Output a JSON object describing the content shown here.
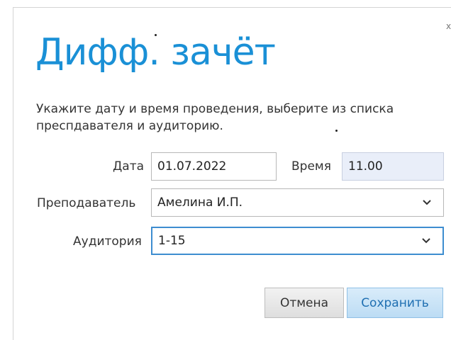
{
  "dialog": {
    "title": "Дифф. зачёт",
    "description": "Укажите дату и время проведения, выберите из списка преспдавателя и аудиторию.",
    "close_icon": "close-icon"
  },
  "form": {
    "date_label": "Дата",
    "date_value": "01.07.2022",
    "time_label": "Время",
    "time_value": "11.00",
    "teacher_label": "Преподаватель",
    "teacher_value": "Амелина И.П.",
    "room_label": "Аудитория",
    "room_value": "1-15",
    "dropdown_icon": "chevron-down-icon"
  },
  "buttons": {
    "cancel_label": "Отмена",
    "save_label": "Сохранить"
  },
  "colors": {
    "accent": "#1a90d6",
    "focus_border": "#3d8dd0",
    "readonly_bg": "#e9eef9",
    "save_bg": "#c8e3f6"
  }
}
